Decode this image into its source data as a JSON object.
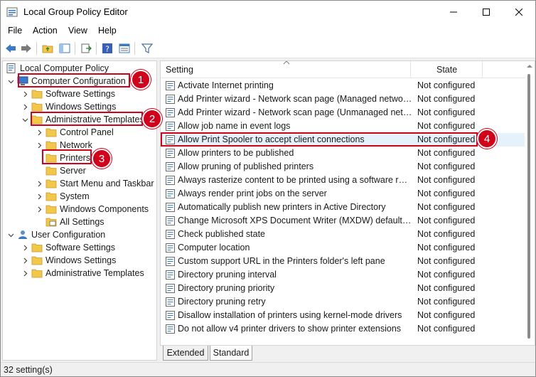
{
  "window": {
    "title": "Local Group Policy Editor"
  },
  "menu": [
    "File",
    "Action",
    "View",
    "Help"
  ],
  "tree": {
    "root": "Local Computer Policy",
    "computer_configuration": "Computer Configuration",
    "cc_software_settings": "Software Settings",
    "cc_windows_settings": "Windows Settings",
    "cc_admin_templates": "Administrative Templates",
    "control_panel": "Control Panel",
    "network": "Network",
    "printers": "Printers",
    "server": "Server",
    "start_menu": "Start Menu and Taskbar",
    "system": "System",
    "windows_components": "Windows Components",
    "all_settings": "All Settings",
    "user_configuration": "User Configuration",
    "uc_software_settings": "Software Settings",
    "uc_windows_settings": "Windows Settings",
    "uc_admin_templates": "Administrative Templates"
  },
  "list": {
    "header_setting": "Setting",
    "header_state": "State",
    "rows": [
      {
        "name": "Activate Internet printing",
        "state": "Not configured"
      },
      {
        "name": "Add Printer wizard - Network scan page (Managed network)",
        "state": "Not configured"
      },
      {
        "name": "Add Printer wizard - Network scan page (Unmanaged network)",
        "state": "Not configured"
      },
      {
        "name": "Allow job name in event logs",
        "state": "Not configured"
      },
      {
        "name": "Allow Print Spooler to accept client connections",
        "state": "Not configured"
      },
      {
        "name": "Allow printers to be published",
        "state": "Not configured"
      },
      {
        "name": "Allow pruning of published printers",
        "state": "Not configured"
      },
      {
        "name": "Always rasterize content to be printed using a software rasterizer",
        "state": "Not configured"
      },
      {
        "name": "Always render print jobs on the server",
        "state": "Not configured"
      },
      {
        "name": "Automatically publish new printers in Active Directory",
        "state": "Not configured"
      },
      {
        "name": "Change Microsoft XPS Document Writer (MXDW) default output format",
        "state": "Not configured"
      },
      {
        "name": "Check published state",
        "state": "Not configured"
      },
      {
        "name": "Computer location",
        "state": "Not configured"
      },
      {
        "name": "Custom support URL in the Printers folder's left pane",
        "state": "Not configured"
      },
      {
        "name": "Directory pruning interval",
        "state": "Not configured"
      },
      {
        "name": "Directory pruning priority",
        "state": "Not configured"
      },
      {
        "name": "Directory pruning retry",
        "state": "Not configured"
      },
      {
        "name": "Disallow installation of printers using kernel-mode drivers",
        "state": "Not configured"
      },
      {
        "name": "Do not allow v4 printer drivers to show printer extensions",
        "state": "Not configured"
      }
    ]
  },
  "tabs": [
    "Extended",
    "Standard"
  ],
  "status": "32 setting(s)",
  "callouts": [
    "1",
    "2",
    "3",
    "4"
  ],
  "colors": {
    "callout_red": "#d0021b",
    "folder_yellow": "#f3c74a",
    "selection": "#e5f1fb"
  }
}
